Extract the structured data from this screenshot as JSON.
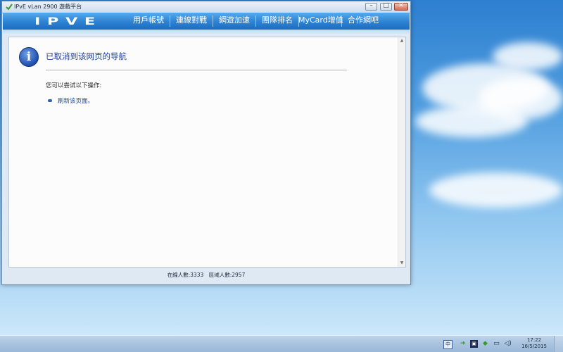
{
  "window": {
    "title": "IPvE vLan 2900 遊戲平台",
    "controls": {
      "minimize": "–",
      "maximize": "□",
      "close": "✕"
    }
  },
  "nav": {
    "logo": "IPVE",
    "items": [
      "用戶帳號",
      "連線對戰",
      "網遊加速",
      "團隊排名",
      "MyCard增值",
      "合作網吧"
    ]
  },
  "page": {
    "error_title": "已取消到该网页的导航",
    "hint": "您可以尝试以下操作:",
    "actions": [
      "刷新该页面。"
    ],
    "info_icon": "i"
  },
  "status": {
    "text": "在線人數:3333　區域人數:2957"
  },
  "taskbar": {
    "tray_icons": [
      "input-method-icon",
      "network-arrow-icon",
      "monitor-icon",
      "shield-icon",
      "display-icon",
      "volume-icon"
    ],
    "time": "17:22",
    "date": "16/5/2015"
  },
  "colors": {
    "nav_top": "#56a9ec",
    "nav_bottom": "#1d6cc0",
    "link": "#1f4fb0",
    "title": "#1a3f9a"
  }
}
